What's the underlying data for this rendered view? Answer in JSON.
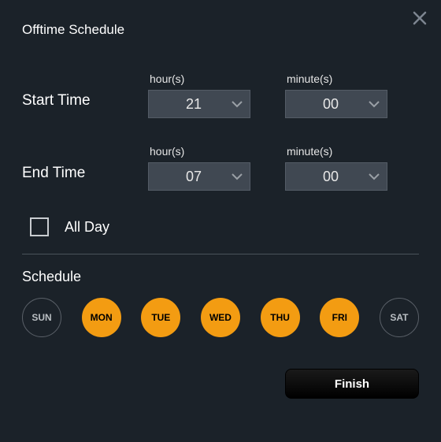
{
  "title": "Offtime Schedule",
  "start": {
    "label": "Start Time",
    "hour_label": "hour(s)",
    "minute_label": "minute(s)",
    "hour_value": "21",
    "minute_value": "00"
  },
  "end": {
    "label": "End Time",
    "hour_label": "hour(s)",
    "minute_label": "minute(s)",
    "hour_value": "07",
    "minute_value": "00"
  },
  "allday": {
    "label": "All Day",
    "checked": false
  },
  "schedule": {
    "label": "Schedule",
    "days": [
      {
        "abbr": "SUN",
        "selected": false
      },
      {
        "abbr": "MON",
        "selected": true
      },
      {
        "abbr": "TUE",
        "selected": true
      },
      {
        "abbr": "WED",
        "selected": true
      },
      {
        "abbr": "THU",
        "selected": true
      },
      {
        "abbr": "FRI",
        "selected": true
      },
      {
        "abbr": "SAT",
        "selected": false
      }
    ]
  },
  "finish_label": "Finish",
  "colors": {
    "panel_bg": "#1b2229",
    "accent": "#f39c12",
    "dropdown_bg": "#404852"
  }
}
